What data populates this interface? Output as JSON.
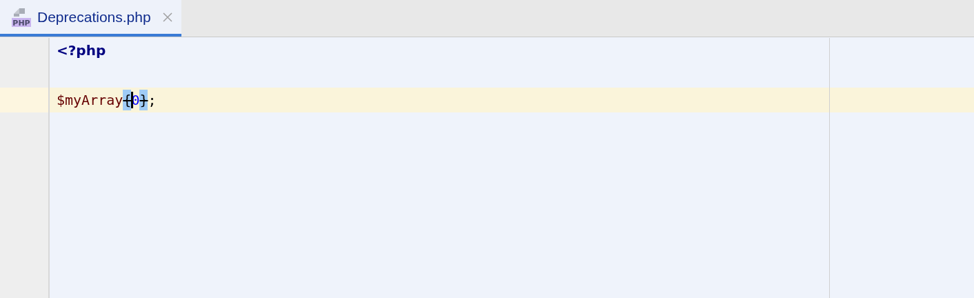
{
  "tabs": [
    {
      "label": "Deprecations.php",
      "selected": true,
      "closable": true,
      "icon_text": "PHP"
    }
  ],
  "editor": {
    "lines": [
      {
        "current": false,
        "tokens": [
          {
            "kind": "keyword",
            "text": "<?php",
            "matched": false,
            "deprecated": false,
            "caret_before": false
          }
        ]
      },
      {
        "current": false
      },
      {
        "current": true,
        "tokens": [
          {
            "kind": "variable",
            "text": "$myArray",
            "matched": false,
            "deprecated": false,
            "caret_before": false
          },
          {
            "kind": "brace",
            "text": "{",
            "matched": true,
            "deprecated": true,
            "caret_before": false
          },
          {
            "kind": "number",
            "text": "0",
            "matched": false,
            "deprecated": false,
            "caret_before": true
          },
          {
            "kind": "brace",
            "text": "}",
            "matched": true,
            "deprecated": true,
            "caret_before": false
          },
          {
            "kind": "punct",
            "text": ";",
            "matched": false,
            "deprecated": false,
            "caret_before": false
          }
        ]
      }
    ]
  }
}
